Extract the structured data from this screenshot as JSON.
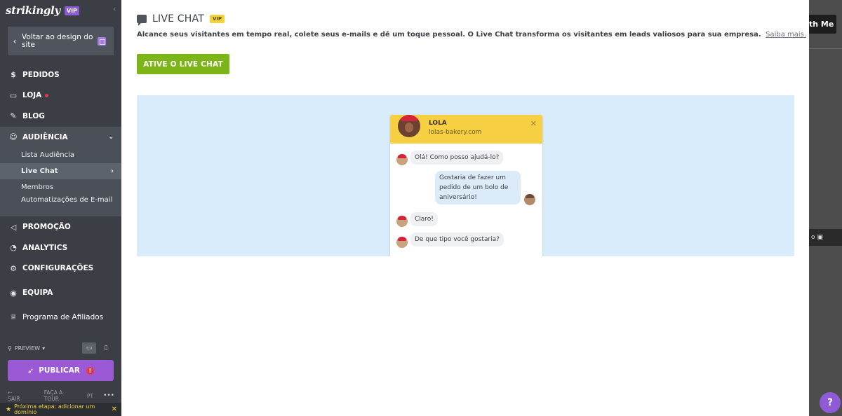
{
  "sidebar": {
    "brand": "strikingly",
    "brand_badge": "VIP",
    "back_label": "Voltar ao design do site",
    "nav": {
      "pedidos": "PEDIDOS",
      "loja": "LOJA",
      "blog": "BLOG",
      "audiencia": "AUDIÊNCIA",
      "promocao": "PROMOÇÃO",
      "analytics": "ANALYTICS",
      "configuracoes": "CONFIGURAÇÕES",
      "equipa": "EQUIPA",
      "afiliados": "Programa de Afiliados"
    },
    "sub": {
      "lista": "Lista Audiência",
      "live_chat": "Live Chat",
      "membros": "Membros",
      "automatizacoes": "Automatizações de E-mail"
    },
    "preview_label": "PREVIEW",
    "publish_label": "PUBLICAR",
    "footer": {
      "sair": "SAIR",
      "tour": "FAÇA A TOUR",
      "lang": "PT",
      "more": "•••"
    },
    "next_step": "Próxima etapa: adicionar um domínio"
  },
  "main": {
    "title": "LIVE CHAT",
    "title_badge": "VIP",
    "description": "Alcance seus visitantes em tempo real, colete seus e-mails e dê um toque pessoal. O Live Chat transforma os visitantes em leads valiosos para sua empresa.",
    "learn_more": "Saiba mais.",
    "activate_label": "ATIVE O LIVE CHAT",
    "widget": {
      "name": "LOLA",
      "site": "lolas-bakery.com",
      "messages": [
        "Olá! Como posso ajudá-lo?",
        "Gostaria de fazer um pedido de um bolo de aniversário!",
        "Claro!",
        "De que tipo você gostaria?"
      ]
    }
  },
  "background": {
    "chip_text": "th Me"
  }
}
